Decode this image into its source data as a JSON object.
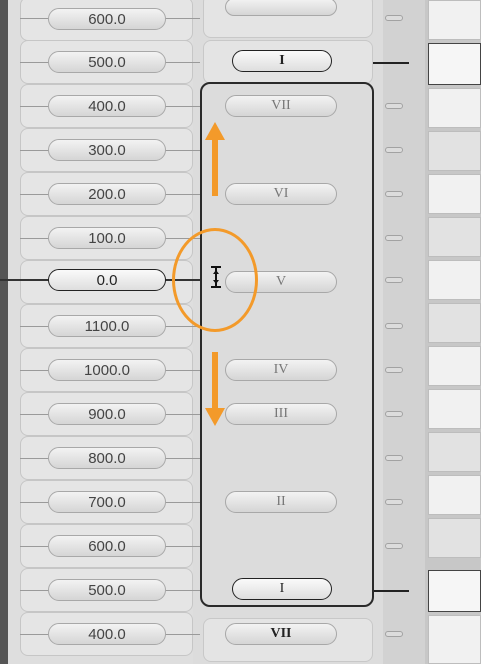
{
  "ticks": {
    "rows": [
      "600.0",
      "500.0",
      "400.0",
      "300.0",
      "200.0",
      "100.0",
      "0.0",
      "1100.0",
      "1000.0",
      "900.0",
      "800.0",
      "700.0",
      "600.0",
      "500.0",
      "400.0"
    ],
    "active_index": 6
  },
  "steps": {
    "labels": [
      "I",
      "VII",
      "VI",
      "V",
      "IV",
      "III",
      "II",
      "I",
      "VII"
    ]
  },
  "annotation": {
    "ring_color": "#f39a2a",
    "arrow_color": "#f39a2a",
    "cursor_icon": "resize-vertical-cursor-icon"
  }
}
